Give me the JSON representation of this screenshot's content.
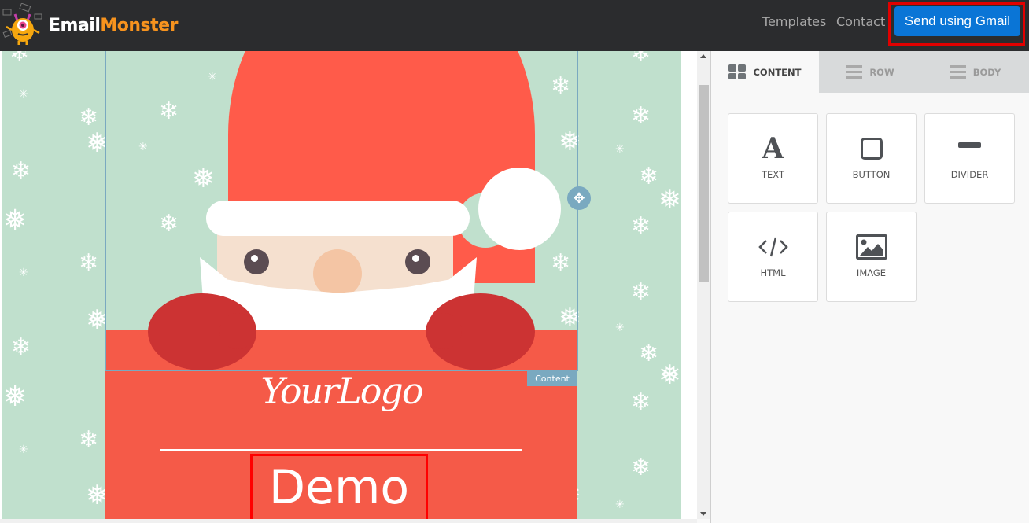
{
  "header": {
    "logo": {
      "part1": "Email",
      "part2": "Monster",
      "icon": "monster-mascot-icon"
    },
    "nav": [
      {
        "label": "Templates"
      },
      {
        "label": "Contact"
      }
    ],
    "send_button": {
      "label": "Send using Gmail",
      "color": "#0a75d6"
    }
  },
  "editor": {
    "template": {
      "theme": "santa-christmas",
      "logo_text": "YourLogo",
      "headline": "Demo",
      "colors": {
        "background": "#c0e0cd",
        "panel": "#f55a48",
        "hat": "#ff5b4a",
        "mitten": "#cc3333"
      }
    },
    "selection": {
      "tag_label": "Content",
      "move_icon": "move-arrows-icon",
      "accent": "#7aa9c0"
    }
  },
  "sidebar": {
    "tabs": [
      {
        "label": "CONTENT",
        "icon": "grid-icon",
        "active": true
      },
      {
        "label": "ROW",
        "icon": "lines-icon",
        "active": false
      },
      {
        "label": "BODY",
        "icon": "lines-icon",
        "active": false
      }
    ],
    "blocks": [
      {
        "label": "TEXT",
        "icon": "text-a-icon"
      },
      {
        "label": "BUTTON",
        "icon": "square-button-icon"
      },
      {
        "label": "DIVIDER",
        "icon": "divider-bar-icon"
      },
      {
        "label": "HTML",
        "icon": "code-icon"
      },
      {
        "label": "IMAGE",
        "icon": "image-icon"
      }
    ]
  }
}
